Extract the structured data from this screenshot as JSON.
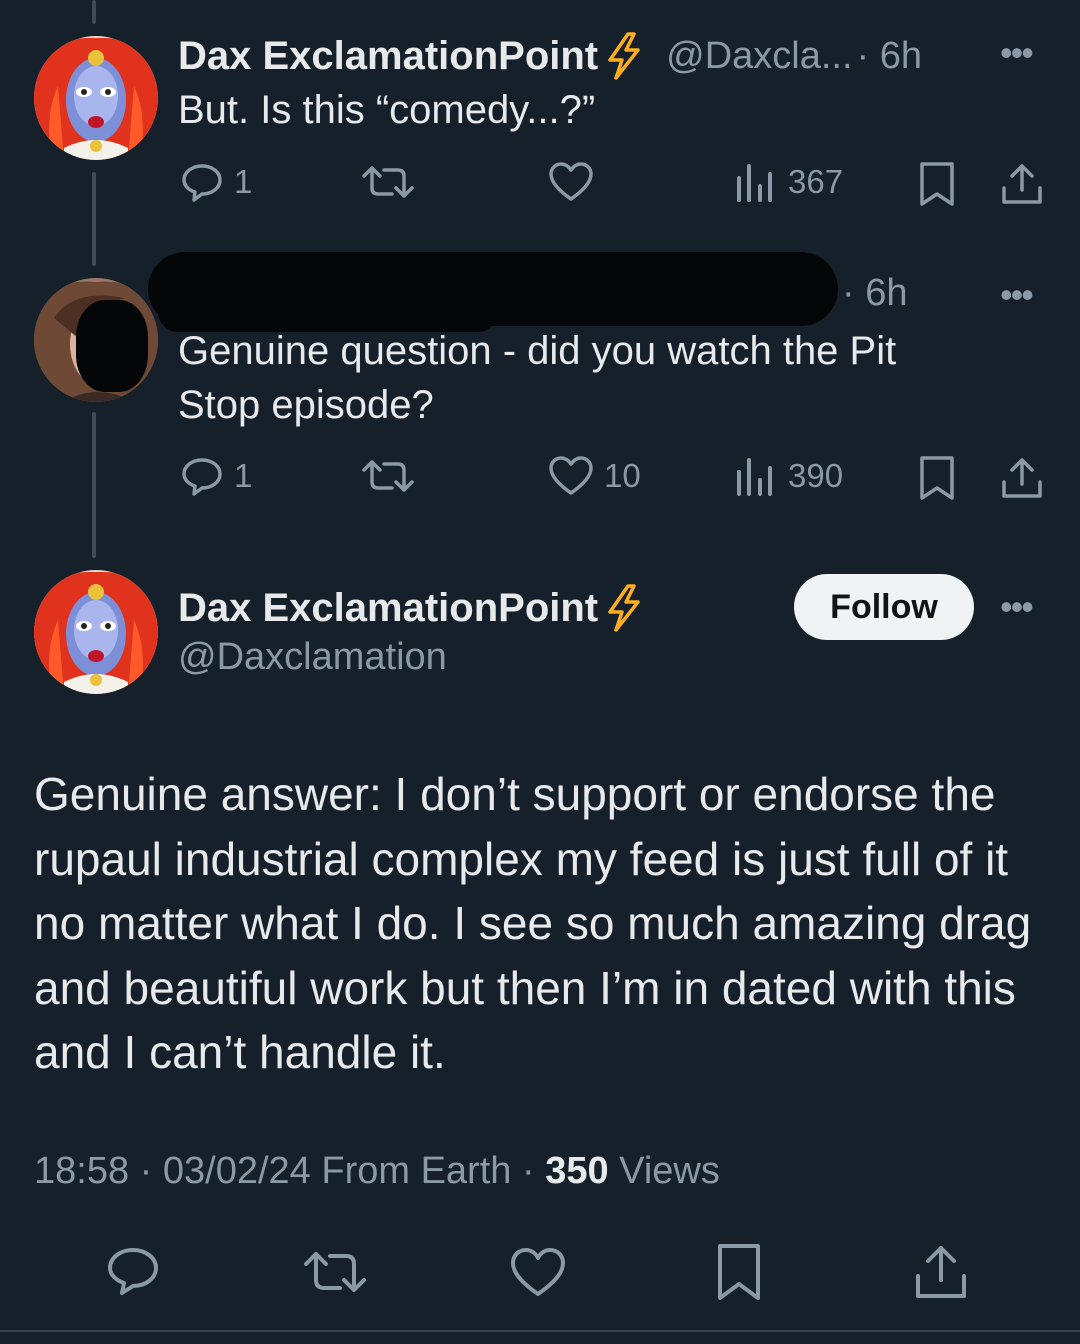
{
  "tweets": [
    {
      "author_name": "Dax ExclamationPoint",
      "verified_icon": "lightning-bolt-icon",
      "handle": "@Daxcla...",
      "time": "· 6h",
      "text": "But. Is this “comedy...?”",
      "replies": "1",
      "likes": "",
      "views": "367"
    },
    {
      "author_name": "",
      "handle": "",
      "time": "· 6h",
      "text": "Genuine question - did you watch the Pit Stop episode?",
      "replies": "1",
      "likes": "10",
      "views": "390"
    }
  ],
  "main": {
    "author_name": "Dax ExclamationPoint",
    "handle": "@Daxclamation",
    "follow_label": "Follow",
    "text": "Genuine answer: I don’t support or endorse the rupaul industrial complex my feed is just full of it no matter what I do. I see so much amazing drag and beautiful work but then I’m in dated with this and I can’t handle it.",
    "time": "18:58",
    "date": "03/02/24",
    "source": "From Earth",
    "views_count": "350",
    "views_label": "Views"
  },
  "colors": {
    "background": "#15202b",
    "text": "#e7e9ea",
    "muted": "#8b98a5",
    "bolt": "#ffad1f",
    "follow_bg": "#eff3f4"
  }
}
